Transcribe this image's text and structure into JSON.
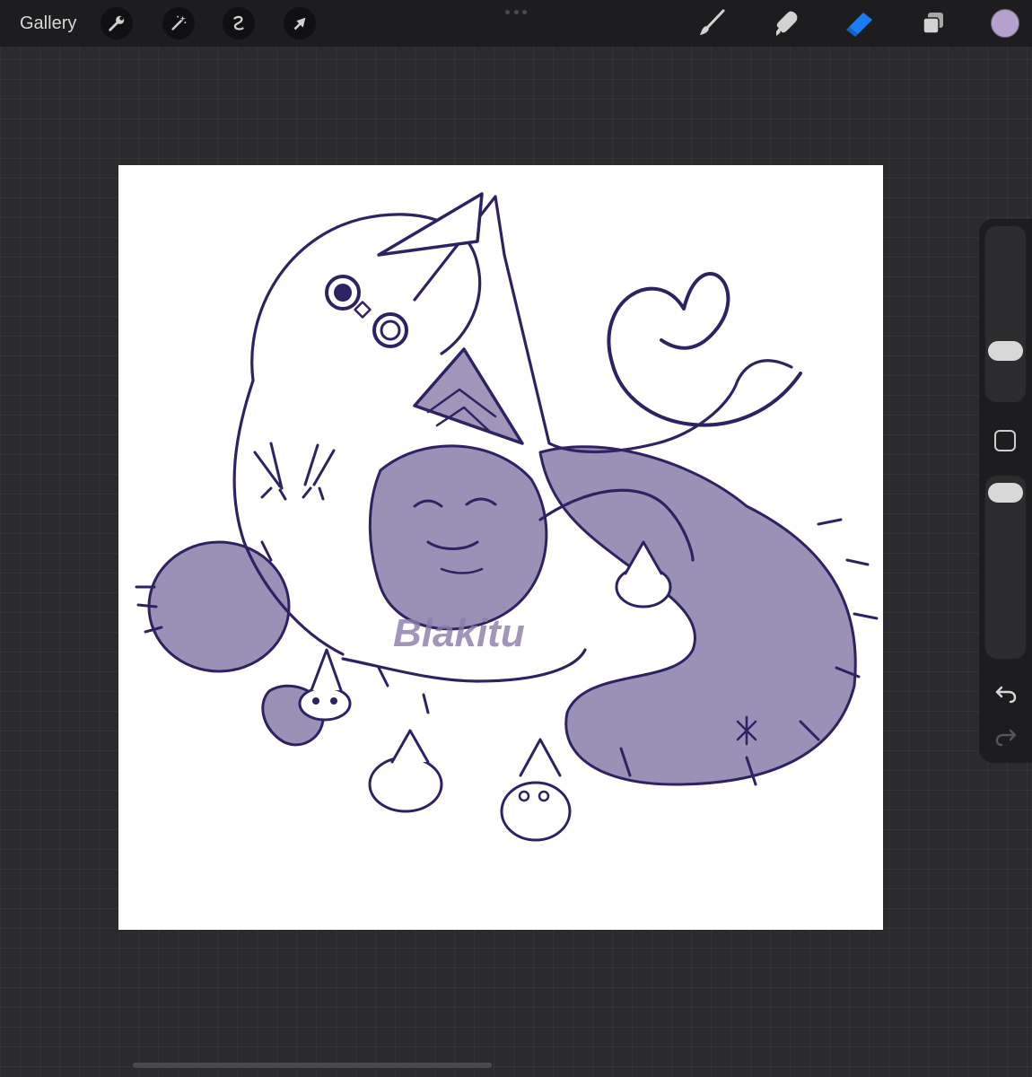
{
  "topbar": {
    "gallery_label": "Gallery",
    "left_tools": [
      "wrench-icon",
      "magic-wand-icon",
      "selection-icon",
      "transform-arrow-icon"
    ],
    "right_tools": [
      "brush-icon",
      "smudge-icon",
      "eraser-icon",
      "layers-icon"
    ],
    "active_tool": "eraser-icon",
    "current_color": "#b6a1ce"
  },
  "canvas": {
    "watermark": "Blakitu"
  },
  "colors": {
    "ink": "#2e2263",
    "fill": "#8a7ca8",
    "accent": "#1a7ef2",
    "toolbar": "#1d1d1f",
    "workspace": "#2b2b2d"
  },
  "sidebar": {
    "brush_size_level": 0.22,
    "opacity_level": 0.06,
    "controls": [
      "brush-size-slider",
      "modify-button",
      "opacity-slider",
      "undo-icon",
      "redo-icon"
    ]
  }
}
